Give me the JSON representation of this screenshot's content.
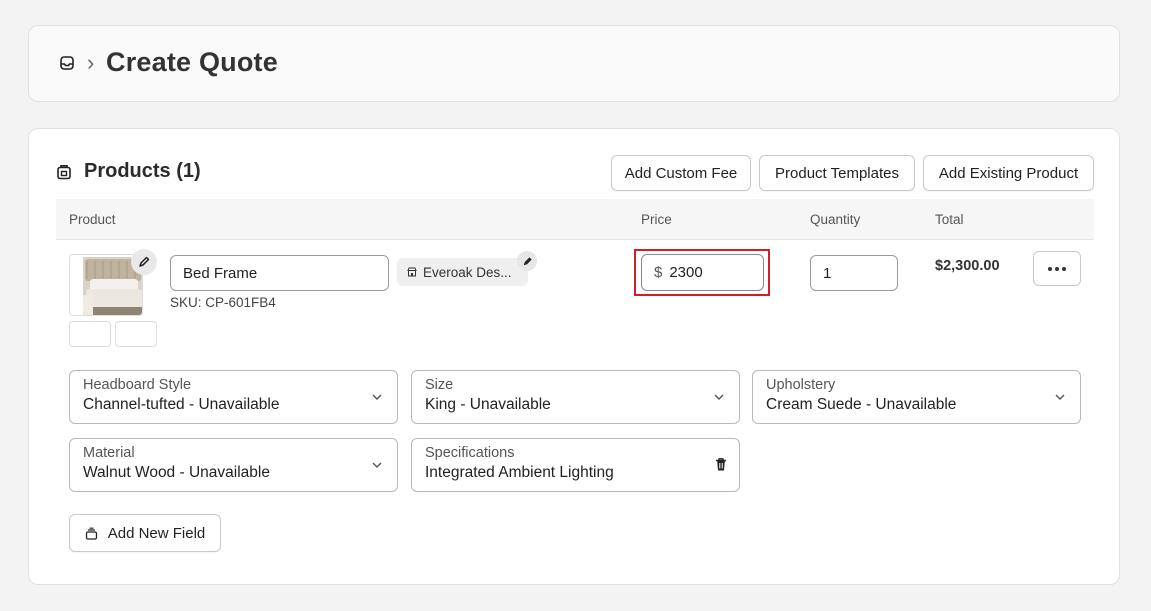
{
  "header": {
    "breadcrumb_separator": "›",
    "title": "Create Quote",
    "icon": "inbox-icon"
  },
  "products": {
    "heading": "Products (1)",
    "icon": "package-icon",
    "actions": {
      "add_custom_fee": "Add Custom Fee",
      "product_templates": "Product Templates",
      "add_existing_product": "Add Existing Product"
    },
    "columns": {
      "product": "Product",
      "price": "Price",
      "quantity": "Quantity",
      "total": "Total"
    },
    "rows": [
      {
        "name": "Bed Frame",
        "sku": "SKU: CP-601FB4",
        "vendor": "Everoak Des...",
        "currency_symbol": "$",
        "price": "2300",
        "quantity": "1",
        "total": "$2,300.00",
        "fields": [
          {
            "label": "Headboard Style",
            "value": "Channel-tufted - Unavailable",
            "type": "select"
          },
          {
            "label": "Size",
            "value": "King - Unavailable",
            "type": "select"
          },
          {
            "label": "Upholstery",
            "value": "Cream Suede - Unavailable",
            "type": "select"
          },
          {
            "label": "Material",
            "value": "Walnut Wood - Unavailable",
            "type": "select"
          },
          {
            "label": "Specifications",
            "value": "Integrated Ambient Lighting",
            "type": "text"
          }
        ]
      }
    ],
    "add_field_label": "Add New Field"
  },
  "colors": {
    "highlight": "#d11f2a",
    "page_background": "#f3f3f3"
  }
}
